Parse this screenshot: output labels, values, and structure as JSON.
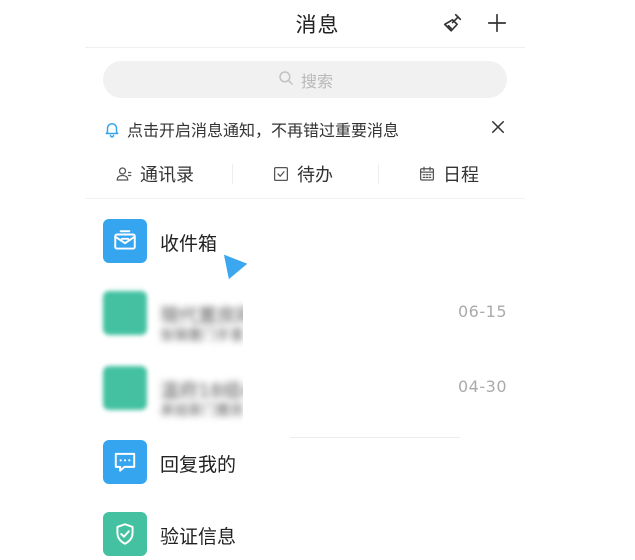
{
  "header": {
    "title": "消息",
    "icons": [
      "broom-icon",
      "plus-icon"
    ]
  },
  "search": {
    "placeholder": "搜索"
  },
  "notice": {
    "text": "点击开启消息通知，不再错过重要消息"
  },
  "shortcuts": [
    {
      "label": "通讯录",
      "icon": "contacts-icon"
    },
    {
      "label": "待办",
      "icon": "checkbox-icon"
    },
    {
      "label": "日程",
      "icon": "calendar-icon"
    }
  ],
  "list": [
    {
      "title": "收件箱",
      "icon": "inbox-icon",
      "color": "#35a5ef"
    },
    {
      "title": "現代置房网",
      "subtitle": "张锦置门手里",
      "time": "06-15",
      "color": "#43c1a1"
    },
    {
      "title": "温府18组4-6",
      "subtitle": "承旭家门置房",
      "time": "04-30",
      "color": "#43c1a1"
    },
    {
      "title": "回复我的",
      "icon": "comment-icon",
      "color": "#35a5ef"
    },
    {
      "title": "验证信息",
      "icon": "shield-check-icon",
      "color": "#43c1a1"
    }
  ],
  "colors": {
    "accent_blue": "#35a5ef",
    "accent_green": "#43c1a1"
  }
}
